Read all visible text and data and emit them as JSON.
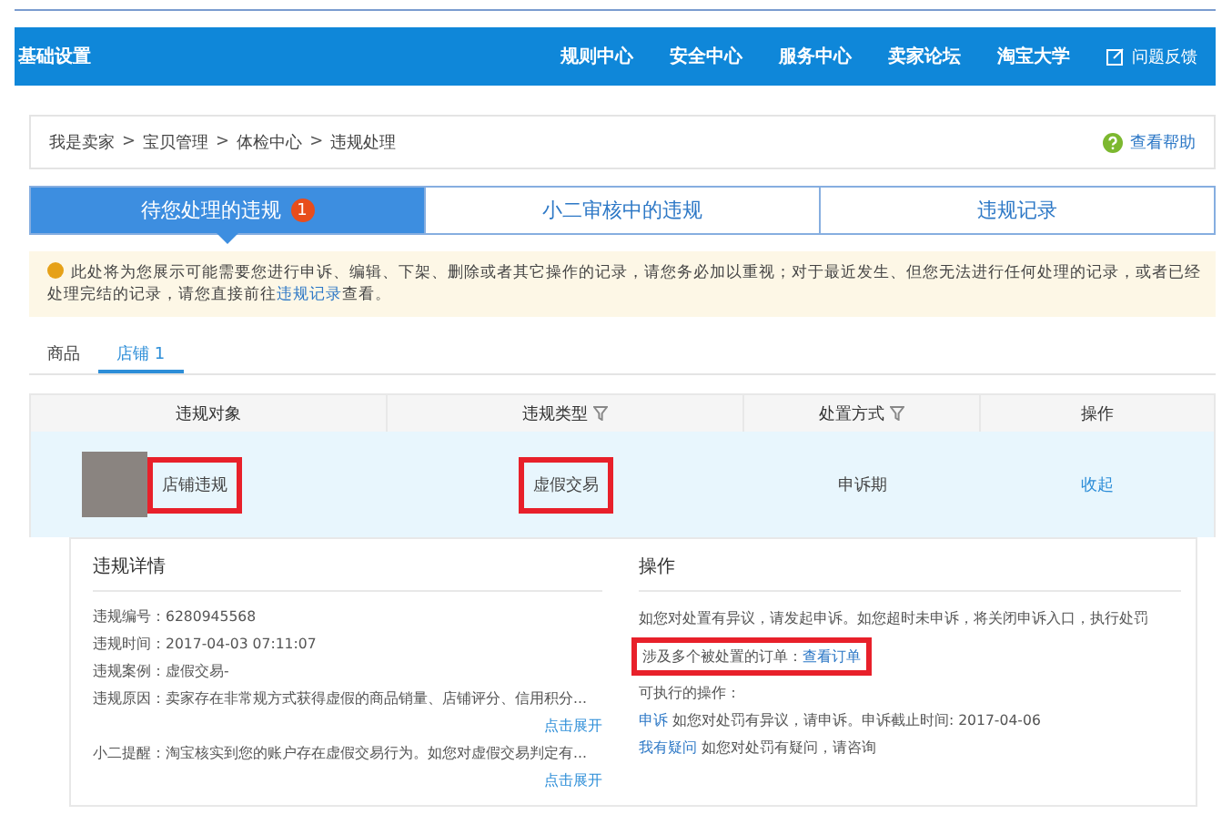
{
  "nav": {
    "title": "基础设置",
    "links": [
      "规则中心",
      "安全中心",
      "服务中心",
      "卖家论坛",
      "淘宝大学"
    ],
    "feedback": "问题反馈"
  },
  "breadcrumb": [
    "我是卖家",
    "宝贝管理",
    "体检中心",
    "违规处理"
  ],
  "separator": ">",
  "help": "查看帮助",
  "tabs": [
    {
      "label": "待您处理的违规",
      "badge": "1",
      "selected": true
    },
    {
      "label": "小二审核中的违规",
      "selected": false
    },
    {
      "label": "违规记录",
      "selected": false
    }
  ],
  "notice": {
    "text": "此处将为您展示可能需要您进行申诉、编辑、下架、删除或者其它操作的记录，请您务必加以重视；对于最近发生、但您无法进行任何处理的记录，或者已经处理完结的记录，请您直接前往",
    "link": "违规记录",
    "after": "查看。"
  },
  "subtabs": [
    {
      "label": "商品",
      "selected": false
    },
    {
      "label": "店铺 1",
      "selected": true
    }
  ],
  "table": {
    "columns": [
      {
        "label": "违规对象",
        "filter": false
      },
      {
        "label": "违规类型",
        "filter": true
      },
      {
        "label": "处置方式",
        "filter": true
      },
      {
        "label": "操作",
        "filter": false
      }
    ],
    "row": {
      "object": {
        "text": "店铺违规",
        "highlighted": true
      },
      "type": {
        "text": "虚假交易",
        "highlighted": true
      },
      "method": "申诉期",
      "action": "收起"
    }
  },
  "details": {
    "title": "违规详情",
    "fields": [
      {
        "label": "违规编号：",
        "value": "6280945568"
      },
      {
        "label": "违规时间：",
        "value": "2017-04-03 07:11:07"
      },
      {
        "label": "违规案例：",
        "value": "虚假交易-"
      },
      {
        "label": "违规原因：",
        "value": "卖家存在非常规方式获得虚假的商品销量、店铺评分、信用积分...",
        "expand": "点击展开"
      },
      {
        "label": "小二提醒：",
        "value": "淘宝核实到您的账户存在虚假交易行为。如您对虚假交易判定有...",
        "expand": "点击展开"
      }
    ]
  },
  "operations": {
    "title": "操作",
    "text": "如您对处置有异议，请发起申诉。如您超时未申诉，将关闭申诉入口，执行处罚",
    "orders": {
      "label": "涉及多个被处置的订单：",
      "link": "查看订单",
      "highlighted": true
    },
    "available": "可执行的操作：",
    "actions": [
      {
        "link": "申诉",
        "text": "如您对处罚有异议，请申诉。申诉截止时间: 2017-04-06"
      },
      {
        "link": "我有疑问",
        "text": "如您对处罚有疑问，请咨询"
      }
    ]
  }
}
